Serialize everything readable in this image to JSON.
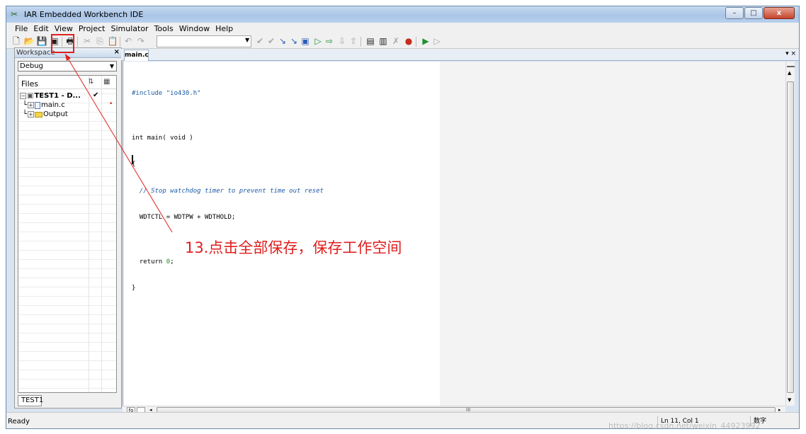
{
  "window": {
    "title": "IAR Embedded Workbench IDE",
    "buttons": {
      "minimize": "–",
      "maximize": "□",
      "close": "x"
    }
  },
  "menu": [
    "File",
    "Edit",
    "View",
    "Project",
    "Simulator",
    "Tools",
    "Window",
    "Help"
  ],
  "toolbar": {
    "icons": [
      "new-file",
      "open",
      "save",
      "save-all",
      "print",
      "cut",
      "copy",
      "paste",
      "undo",
      "redo",
      "dropdown",
      "toggle-breakpoint",
      "go",
      "step",
      "compile",
      "make",
      "debug",
      "stop-debug"
    ]
  },
  "workspace": {
    "title": "Workspace",
    "close": "×",
    "config": "Debug",
    "files_label": "Files",
    "tree": [
      {
        "label": "TEST1 - D...",
        "check": "✔"
      },
      {
        "label": "main.c",
        "dot": "•"
      },
      {
        "label": "Output"
      }
    ],
    "tab": "TEST1"
  },
  "editor": {
    "tab": "main.c",
    "tab_right": "▾ ×",
    "lines": [
      {
        "cls": "pp",
        "text": "#include \"io430.h\""
      },
      {
        "cls": "kw",
        "text": ""
      },
      {
        "cls": "kw",
        "text": "int main( void )"
      },
      {
        "cls": "kw",
        "text": "{"
      },
      {
        "cls": "cm",
        "text": "  // Stop watchdog timer to prevent time out reset"
      },
      {
        "cls": "kw",
        "text": "  WDTCTL = WDTPW + WDTHOLD;"
      },
      {
        "cls": "kw",
        "text": ""
      },
      {
        "cls": "kw",
        "text": "  return 0;"
      },
      {
        "cls": "kw",
        "text": "}"
      }
    ]
  },
  "hscroll": {
    "label": "fo",
    "grip": "III"
  },
  "statusbar": {
    "ready": "Ready",
    "position": "Ln 11, Col 1",
    "mode": "数字"
  },
  "watermark": "https://blog.csdn.net/weixin_44923992",
  "annotation": {
    "text": "13.点击全部保存，保存工作空间",
    "color": "#e01e1e"
  }
}
